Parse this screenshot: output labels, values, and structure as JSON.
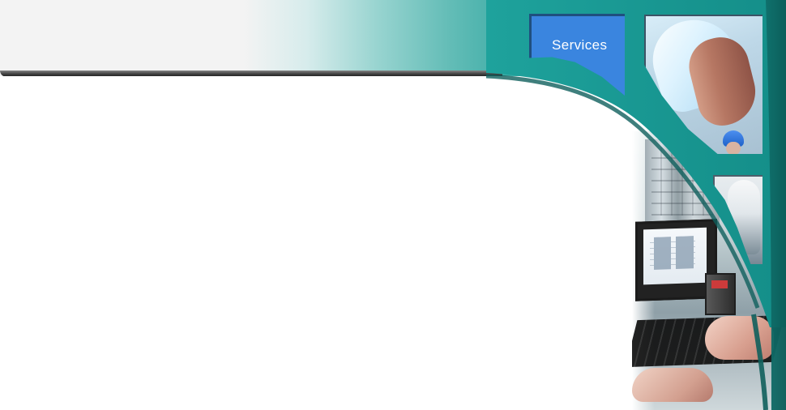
{
  "navigation": {
    "tabs": [
      {
        "label": "Services"
      }
    ]
  },
  "icons": {
    "photo_top": "worker-photo-icon",
    "photo_mid": "technician-photo-icon",
    "photo_panel": "keyboard-photo-icon"
  },
  "colors": {
    "teal_primary": "#1f9f99",
    "teal_dark": "#15847f",
    "services_blue": "#3a85df",
    "header_light": "#f3f3f3",
    "shadow_dark": "#2f2f2f"
  }
}
